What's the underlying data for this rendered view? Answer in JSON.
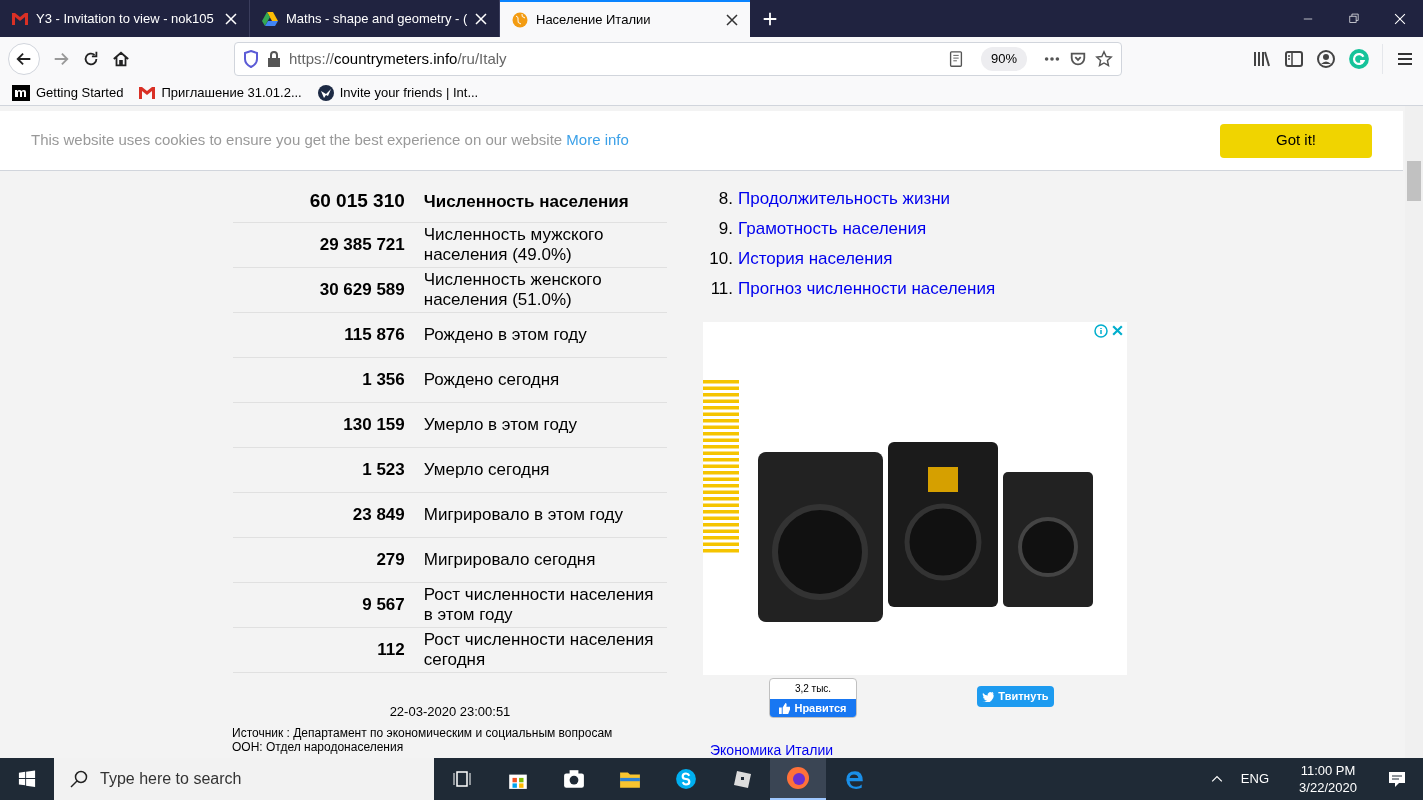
{
  "tabs": [
    {
      "title": "Y3 - Invitation to view - nok105",
      "kind": "mail",
      "selected": false
    },
    {
      "title": "Maths - shape and geometry - (",
      "kind": "drive",
      "selected": false
    },
    {
      "title": "Население Италии",
      "kind": "globe",
      "selected": true
    }
  ],
  "address_bar": {
    "prefix": "https://",
    "domain": "countrymeters.info",
    "path": "/ru/Italy",
    "zoom": "90%"
  },
  "bookmarks": [
    {
      "label": "Getting Started",
      "kind": "m"
    },
    {
      "label": "Приглашение 31.01.2...",
      "kind": "mail"
    },
    {
      "label": "Invite your friends | Int...",
      "kind": "bird"
    }
  ],
  "cookie_banner": {
    "text": "This website uses cookies to ensure you get the best experience on our website",
    "link": "More info",
    "button": "Got it!"
  },
  "stats": [
    {
      "value": "60 015 310",
      "label": "Численность населения",
      "kind": "main"
    },
    {
      "value": "29 385 721",
      "label": "Численность мужского населения (49.0%)",
      "kind": "row"
    },
    {
      "value": "30 629 589",
      "label": "Численность женского населения (51.0%)",
      "kind": "row"
    },
    {
      "value": "115 876",
      "label": "Рождено в этом году",
      "kind": "row"
    },
    {
      "value": "1 356",
      "label": "Рождено сегодня",
      "kind": "row"
    },
    {
      "value": "130 159",
      "label": "Умерло в этом году",
      "kind": "row"
    },
    {
      "value": "1 523",
      "label": "Умерло сегодня",
      "kind": "row"
    },
    {
      "value": "23 849",
      "label": "Мигрировало в этом году",
      "kind": "row"
    },
    {
      "value": "279",
      "label": "Мигрировало сегодня",
      "kind": "row"
    },
    {
      "value": "9 567",
      "label": "Рост численности населения в этом году",
      "kind": "row"
    },
    {
      "value": "112",
      "label": "Рост численности населения сегодня",
      "kind": "row"
    }
  ],
  "timestamp": "22-03-2020 23:00:51",
  "source": {
    "text": "Источник : Департамент по экономическим и социальным вопросам ООН: Отдел народонаселения"
  },
  "contents": [
    {
      "number": "8.",
      "label": "Продолжительность жизни"
    },
    {
      "number": "9.",
      "label": "Грамотность населения"
    },
    {
      "number": "10.",
      "label": "История населения"
    },
    {
      "number": "11.",
      "label": "Прогноз численности населения"
    }
  ],
  "like_button": {
    "count": "3,2 тыс.",
    "label": "Нравится"
  },
  "tweet_button": {
    "label": "Твитнуть"
  },
  "next_link": "Экономика Италии",
  "taskbar": {
    "search_placeholder": "Type here to search",
    "language": "ENG",
    "time": "11:00 PM",
    "date": "3/22/2020"
  }
}
